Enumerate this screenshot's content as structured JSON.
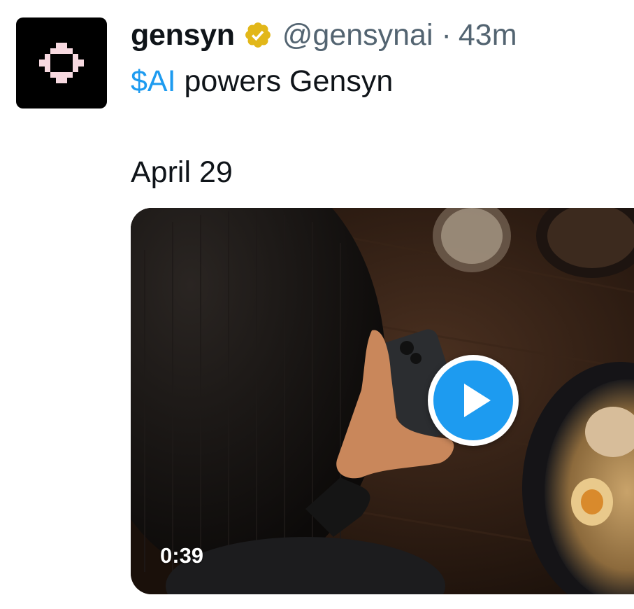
{
  "tweet": {
    "display_name": "gensyn",
    "handle": "@gensynai",
    "separator": "·",
    "time": "43m",
    "text_cashtag": "$AI",
    "text_rest": " powers Gensyn",
    "text_line2": "April 29"
  },
  "media": {
    "duration": "0:39"
  },
  "colors": {
    "accent": "#1d9bf0",
    "verified_gold": "#e2b719",
    "muted_text": "#536471",
    "avatar_mark": "#f7d9e0"
  },
  "icons": {
    "avatar": "gensyn-logo",
    "verified": "verified-badge-icon",
    "play": "play-icon"
  }
}
